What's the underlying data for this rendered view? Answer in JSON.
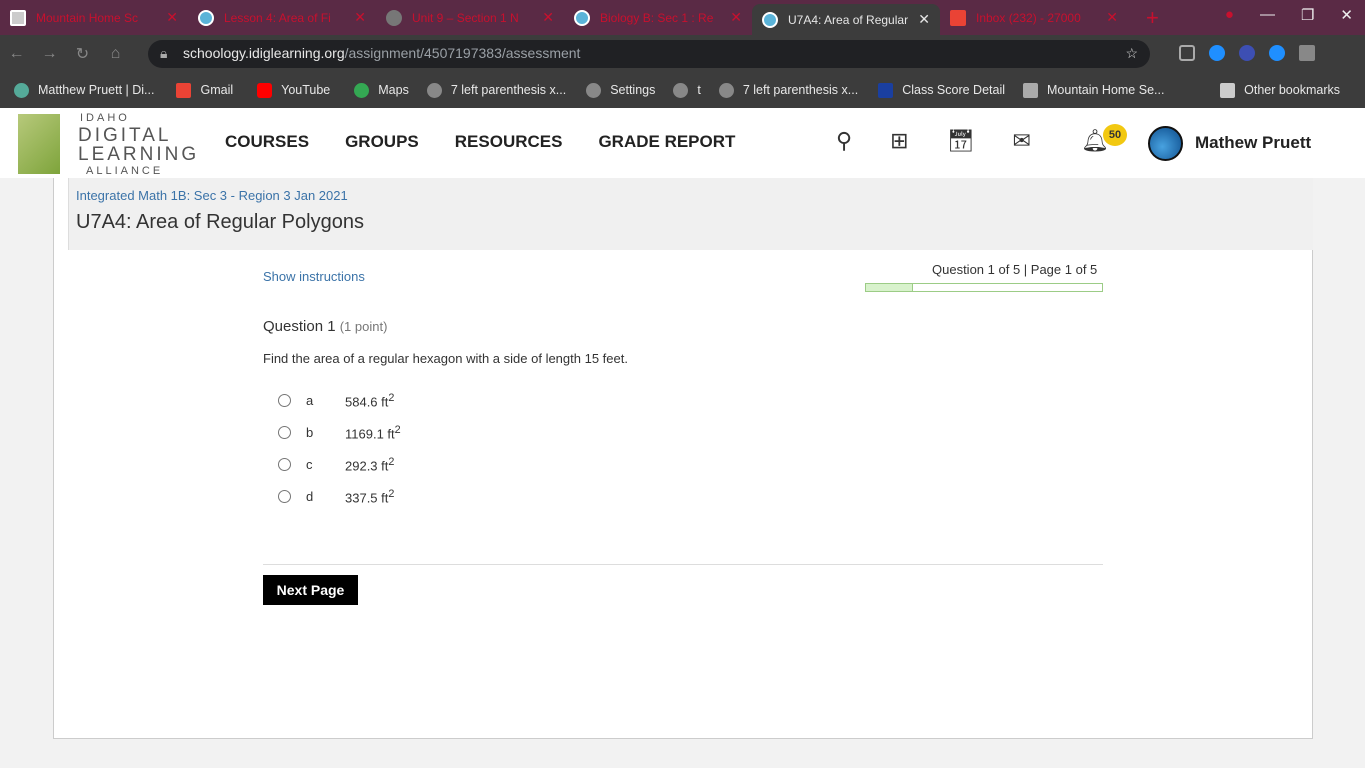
{
  "browser": {
    "tabs": [
      {
        "title": "Mountain Home Sc",
        "active": false
      },
      {
        "title": "Lesson 4: Area of Fi",
        "active": false
      },
      {
        "title": "Unit 9 – Section 1 N",
        "active": false
      },
      {
        "title": "Biology B: Sec 1 : Re",
        "active": false
      },
      {
        "title": "U7A4: Area of Regular",
        "active": true
      },
      {
        "title": "Inbox (232) - 27000",
        "active": false
      }
    ],
    "url_host": "schoology.idiglearning.org",
    "url_path": "/assignment/4507197383/assessment",
    "bookmarks": [
      "Matthew Pruett | Di...",
      "Gmail",
      "YouTube",
      "Maps",
      "7 left parenthesis x...",
      "Settings",
      "t",
      "7 left parenthesis x...",
      "Class Score Detail",
      "Mountain Home Se..."
    ],
    "other_bookmarks": "Other bookmarks"
  },
  "header": {
    "logo": {
      "line1": "IDAHO",
      "line2": "DIGITAL",
      "line3": "LEARNING",
      "line4": "ALLIANCE"
    },
    "nav": [
      "COURSES",
      "GROUPS",
      "RESOURCES",
      "GRADE REPORT"
    ],
    "notification_count": "50",
    "user_name": "Mathew Pruett"
  },
  "assessment": {
    "breadcrumb": "Integrated Math 1B: Sec 3 - Region 3 Jan 2021",
    "title": "U7A4: Area of Regular Polygons",
    "show_instructions": "Show instructions",
    "question_count": "Question 1 of 5 | Page 1 of 5",
    "progress_percent": 20,
    "question_label": "Question 1",
    "points": "(1 point)",
    "question_text": "Find the area of a regular hexagon with a side of length 15 feet.",
    "options": [
      {
        "letter": "a",
        "value": "584.6 ft",
        "sup": "2"
      },
      {
        "letter": "b",
        "value": "1169.1 ft",
        "sup": "2"
      },
      {
        "letter": "c",
        "value": "292.3 ft",
        "sup": "2"
      },
      {
        "letter": "d",
        "value": "337.5 ft",
        "sup": "2"
      }
    ],
    "next_button": "Next Page"
  }
}
